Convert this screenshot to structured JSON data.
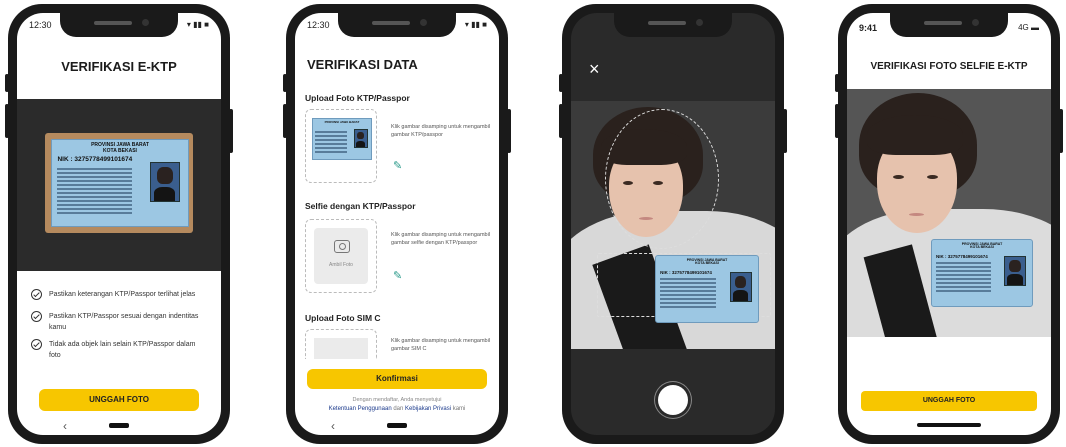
{
  "screen1": {
    "status_time": "12:30",
    "title": "VERIFIKASI E-KTP",
    "ktp": {
      "province": "PROVINSI JAWA BARAT",
      "city": "KOTA BEKASI",
      "nik_label": "NIK",
      "nik": ": 3275778499101674"
    },
    "checklist": [
      "Pastikan keterangan KTP/Passpor terlihat jelas",
      "Pastikan KTP/Passpor sesuai dengan indentitas kamu",
      "Tidak ada objek lain selain KTP/Passpor dalam foto"
    ],
    "button": "UNGGAH FOTO",
    "nav_back": "‹"
  },
  "screen2": {
    "status_time": "12:30",
    "title": "VERIFIKASI DATA",
    "section1": {
      "title": "Upload Foto KTP/Passpor",
      "hint": "Klik gambar disamping untuk mengambil gambar KTP/passpor"
    },
    "section2": {
      "title": "Selfie dengan KTP/Passpor",
      "hint": "Klik gambar disamping untuk mengambil gambar selfie dengan KTP/passpor",
      "placeholder": "Ambil Foto"
    },
    "section3": {
      "title": "Upload Foto SIM C",
      "hint": "Klik gambar disamping untuk mengambil gambar SIM C"
    },
    "button": "Konfirmasi",
    "terms_prefix": "Dengan mendaftar, Anda menyetujui",
    "terms_link1": "Ketentuan Penggunaan",
    "terms_and": "dan",
    "terms_link2": "Kebijakan Privasi",
    "terms_suffix": "kami",
    "nav_back": "‹"
  },
  "screen3": {
    "close": "×",
    "ktp": {
      "province": "PROVINSI JAWA BARAT",
      "city": "KOTA BEKASI",
      "nik": "NIK : 3275778499101674"
    }
  },
  "screen4": {
    "status_time": "9:41",
    "network": "4G",
    "title": "VERIFIKASI FOTO SELFIE E-KTP",
    "ktp": {
      "province": "PROVINSI JAWA BARAT",
      "city": "KOTA BEKASI",
      "nik": "NIK : 3275778499101674"
    },
    "button": "UNGGAH FOTO"
  },
  "colors": {
    "accent": "#f7c600",
    "edit_icon": "#2a9a8a",
    "link": "#1b3a8c",
    "frame": "#1a1a1a"
  }
}
